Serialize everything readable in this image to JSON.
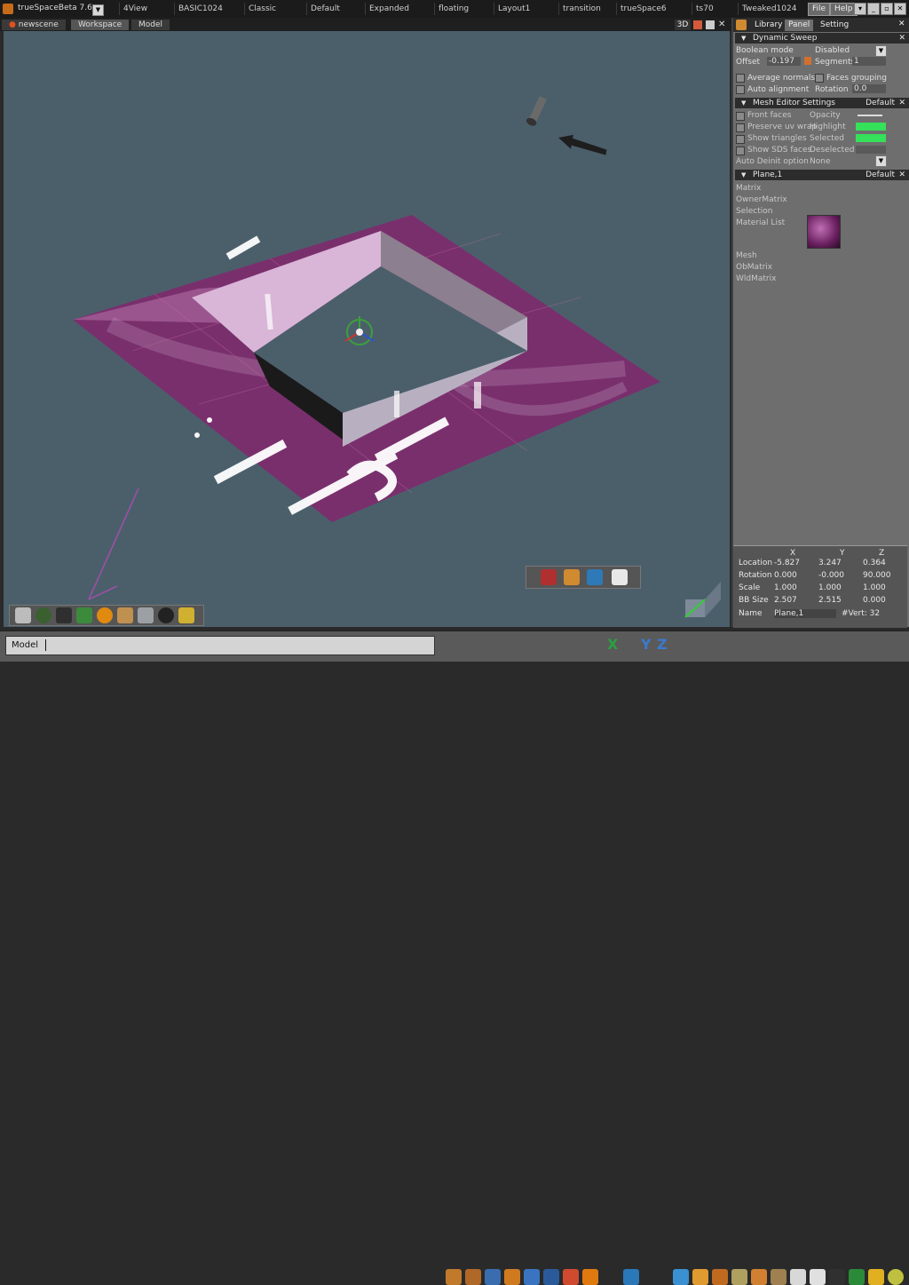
{
  "app": {
    "title": "trueSpaceBeta 7.6"
  },
  "layouts": [
    "4View",
    "BASIC1024",
    "Classic",
    "Default",
    "Expanded",
    "floating",
    "Layout1",
    "transition",
    "trueSpace6",
    "ts70",
    "Tweaked1024"
  ],
  "menus": {
    "file": "File",
    "help": "Help"
  },
  "view_tabs": {
    "tab1": "newscene",
    "tab2": "Workspace",
    "tab3": "Model"
  },
  "viewport": {
    "mode": "3D"
  },
  "panel_tabs": {
    "library": "Library",
    "panel": "Panel",
    "setting": "Setting"
  },
  "dynamic_sweep": {
    "title": "Dynamic Sweep",
    "boolean_mode_label": "Boolean mode",
    "boolean_mode_value": "Disabled",
    "offset_label": "Offset",
    "offset_value": "-0.197",
    "segments_label": "Segments",
    "segments_value": "1",
    "average_normals": "Average normals",
    "faces_grouping": "Faces grouping",
    "auto_alignment": "Auto alignment",
    "rotation_label": "Rotation",
    "rotation_value": "0.0"
  },
  "mesh_editor": {
    "title": "Mesh Editor Settings",
    "default": "Default",
    "front_faces": "Front faces",
    "opacity": "Opacity",
    "preserve_uv": "Preserve uv wrap",
    "highlight": "Highlight",
    "show_triangles": "Show triangles",
    "selected": "Selected",
    "show_sds": "Show SDS faces",
    "deselected": "Deselected",
    "auto_deinit_label": "Auto Deinit option",
    "auto_deinit_value": "None",
    "highlight_color": "#35e05a",
    "selected_color": "#35e05a"
  },
  "plane_section": {
    "title": "Plane,1",
    "default": "Default",
    "items": [
      "Matrix",
      "OwnerMatrix",
      "Selection",
      "Material List"
    ],
    "items2": [
      "Mesh",
      "ObMatrix",
      "WldMatrix"
    ]
  },
  "transform": {
    "axes": [
      "X",
      "Y",
      "Z"
    ],
    "rows": [
      {
        "label": "Location",
        "x": "-5.827",
        "y": "3.247",
        "z": "0.364"
      },
      {
        "label": "Rotation",
        "x": "0.000",
        "y": "-0.000",
        "z": "90.000"
      },
      {
        "label": "Scale",
        "x": "1.000",
        "y": "1.000",
        "z": "1.000"
      },
      {
        "label": "BB Size",
        "x": "2.507",
        "y": "2.515",
        "z": "0.000"
      }
    ],
    "name_label": "Name",
    "name_value": "Plane,1",
    "verts": "#Vert: 32"
  },
  "statusbar": {
    "model": "Model"
  },
  "axis_toolbar": {
    "x": "X",
    "y": "Y",
    "z": "Z"
  }
}
